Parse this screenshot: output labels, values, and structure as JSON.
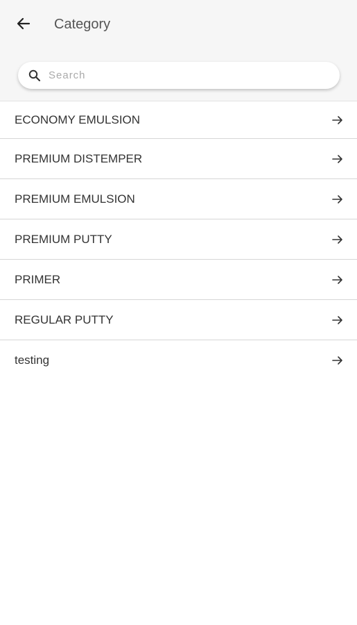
{
  "header": {
    "title": "Category",
    "back_icon": "arrow-left-icon"
  },
  "search": {
    "placeholder": "Search",
    "value": "",
    "icon": "search-icon"
  },
  "categories": {
    "items": [
      {
        "label": "ECONOMY EMULSION",
        "icon": "arrow-right-icon"
      },
      {
        "label": "PREMIUM DISTEMPER",
        "icon": "arrow-right-icon"
      },
      {
        "label": "PREMIUM EMULSION",
        "icon": "arrow-right-icon"
      },
      {
        "label": "PREMIUM PUTTY",
        "icon": "arrow-right-icon"
      },
      {
        "label": "PRIMER",
        "icon": "arrow-right-icon"
      },
      {
        "label": "REGULAR PUTTY",
        "icon": "arrow-right-icon"
      },
      {
        "label": "testing",
        "icon": "arrow-right-icon"
      }
    ]
  },
  "colors": {
    "header_background": "#f6f6f6",
    "text": "#333333",
    "divider": "#d6d6d6"
  }
}
